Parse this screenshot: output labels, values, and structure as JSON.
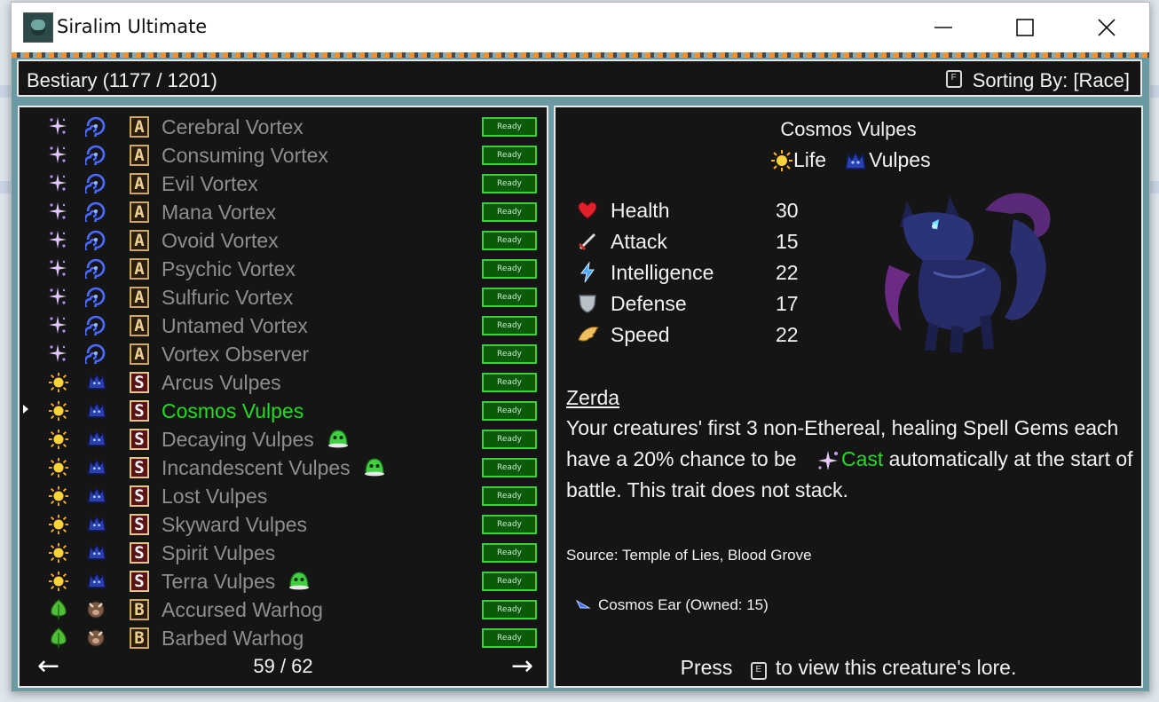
{
  "window": {
    "title": "Siralim Ultimate"
  },
  "header": {
    "title": "Bestiary (1177 / 1201)",
    "sort_key": "F",
    "sort_label": "Sorting By: [Race]"
  },
  "list": {
    "status_label": "Ready",
    "items": [
      {
        "name": "Cerebral Vortex",
        "class": "Sorcery",
        "race": "Vortex",
        "rank": "A",
        "selected": false,
        "slime": false
      },
      {
        "name": "Consuming Vortex",
        "class": "Sorcery",
        "race": "Vortex",
        "rank": "A",
        "selected": false,
        "slime": false
      },
      {
        "name": "Evil Vortex",
        "class": "Sorcery",
        "race": "Vortex",
        "rank": "A",
        "selected": false,
        "slime": false
      },
      {
        "name": "Mana Vortex",
        "class": "Sorcery",
        "race": "Vortex",
        "rank": "A",
        "selected": false,
        "slime": false
      },
      {
        "name": "Ovoid Vortex",
        "class": "Sorcery",
        "race": "Vortex",
        "rank": "A",
        "selected": false,
        "slime": false
      },
      {
        "name": "Psychic Vortex",
        "class": "Sorcery",
        "race": "Vortex",
        "rank": "A",
        "selected": false,
        "slime": false
      },
      {
        "name": "Sulfuric Vortex",
        "class": "Sorcery",
        "race": "Vortex",
        "rank": "A",
        "selected": false,
        "slime": false
      },
      {
        "name": "Untamed Vortex",
        "class": "Sorcery",
        "race": "Vortex",
        "rank": "A",
        "selected": false,
        "slime": false
      },
      {
        "name": "Vortex Observer",
        "class": "Sorcery",
        "race": "Vortex",
        "rank": "A",
        "selected": false,
        "slime": false
      },
      {
        "name": "Arcus Vulpes",
        "class": "Life",
        "race": "Vulpes",
        "rank": "S",
        "selected": false,
        "slime": false
      },
      {
        "name": "Cosmos Vulpes",
        "class": "Life",
        "race": "Vulpes",
        "rank": "S",
        "selected": true,
        "slime": false
      },
      {
        "name": "Decaying Vulpes",
        "class": "Life",
        "race": "Vulpes",
        "rank": "S",
        "selected": false,
        "slime": true
      },
      {
        "name": "Incandescent Vulpes",
        "class": "Life",
        "race": "Vulpes",
        "rank": "S",
        "selected": false,
        "slime": true
      },
      {
        "name": "Lost Vulpes",
        "class": "Life",
        "race": "Vulpes",
        "rank": "S",
        "selected": false,
        "slime": false
      },
      {
        "name": "Skyward Vulpes",
        "class": "Life",
        "race": "Vulpes",
        "rank": "S",
        "selected": false,
        "slime": false
      },
      {
        "name": "Spirit Vulpes",
        "class": "Life",
        "race": "Vulpes",
        "rank": "S",
        "selected": false,
        "slime": false
      },
      {
        "name": "Terra Vulpes",
        "class": "Life",
        "race": "Vulpes",
        "rank": "S",
        "selected": false,
        "slime": true
      },
      {
        "name": "Accursed Warhog",
        "class": "Nature",
        "race": "Warhog",
        "rank": "B",
        "selected": false,
        "slime": false
      },
      {
        "name": "Barbed Warhog",
        "class": "Nature",
        "race": "Warhog",
        "rank": "B",
        "selected": false,
        "slime": false
      }
    ],
    "page": "59 / 62",
    "prev_icon": "left-arrow-icon",
    "next_icon": "right-arrow-icon"
  },
  "detail": {
    "name": "Cosmos Vulpes",
    "class_label": "Life",
    "race_label": "Vulpes",
    "stats": [
      {
        "label": "Health",
        "value": "30",
        "icon": "heart-icon"
      },
      {
        "label": "Attack",
        "value": "15",
        "icon": "sword-icon"
      },
      {
        "label": "Intelligence",
        "value": "22",
        "icon": "lightning-icon"
      },
      {
        "label": "Defense",
        "value": "17",
        "icon": "shield-icon"
      },
      {
        "label": "Speed",
        "value": "22",
        "icon": "wing-icon"
      }
    ],
    "trait_name": "Zerda",
    "trait_desc_1": "Your creatures' first 3 non-Ethereal, healing Spell Gems each have a 20% chance to be",
    "trait_cast": "Cast",
    "trait_desc_2": "automatically at the start of battle. This trait does not stack.",
    "source": "Source: Temple of Lies, Blood Grove",
    "item": "Cosmos Ear (Owned: 15)",
    "press_prefix": "Press",
    "press_key": "E",
    "press_suffix": "to view this creature's lore."
  },
  "colors": {
    "selected": "#22dd22",
    "ready_bg": "#0a5a0a",
    "ready_border": "#3ccf3c",
    "panel_bg": "#151515"
  }
}
